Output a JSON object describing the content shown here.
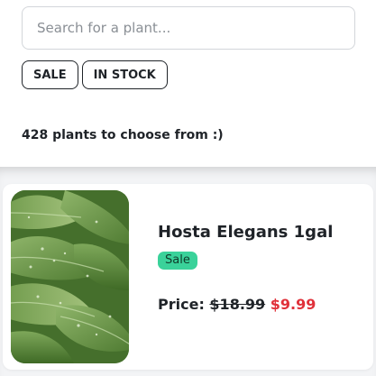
{
  "search": {
    "placeholder": "Search for a plant...",
    "value": ""
  },
  "filters": [
    {
      "label": "SALE"
    },
    {
      "label": "IN STOCK"
    }
  ],
  "results": {
    "count_text": "428 plants to choose from :)"
  },
  "products": [
    {
      "title": "Hosta Elegans 1gal",
      "badge": "Sale",
      "price_label": "Price:",
      "original_price": "$18.99",
      "sale_price": "$9.99",
      "image_icon": "hosta-leaves-photo"
    }
  ],
  "colors": {
    "badge_bg": "#3ad29a",
    "sale_price": "#e0313a",
    "list_bg": "#f3f4f6"
  }
}
